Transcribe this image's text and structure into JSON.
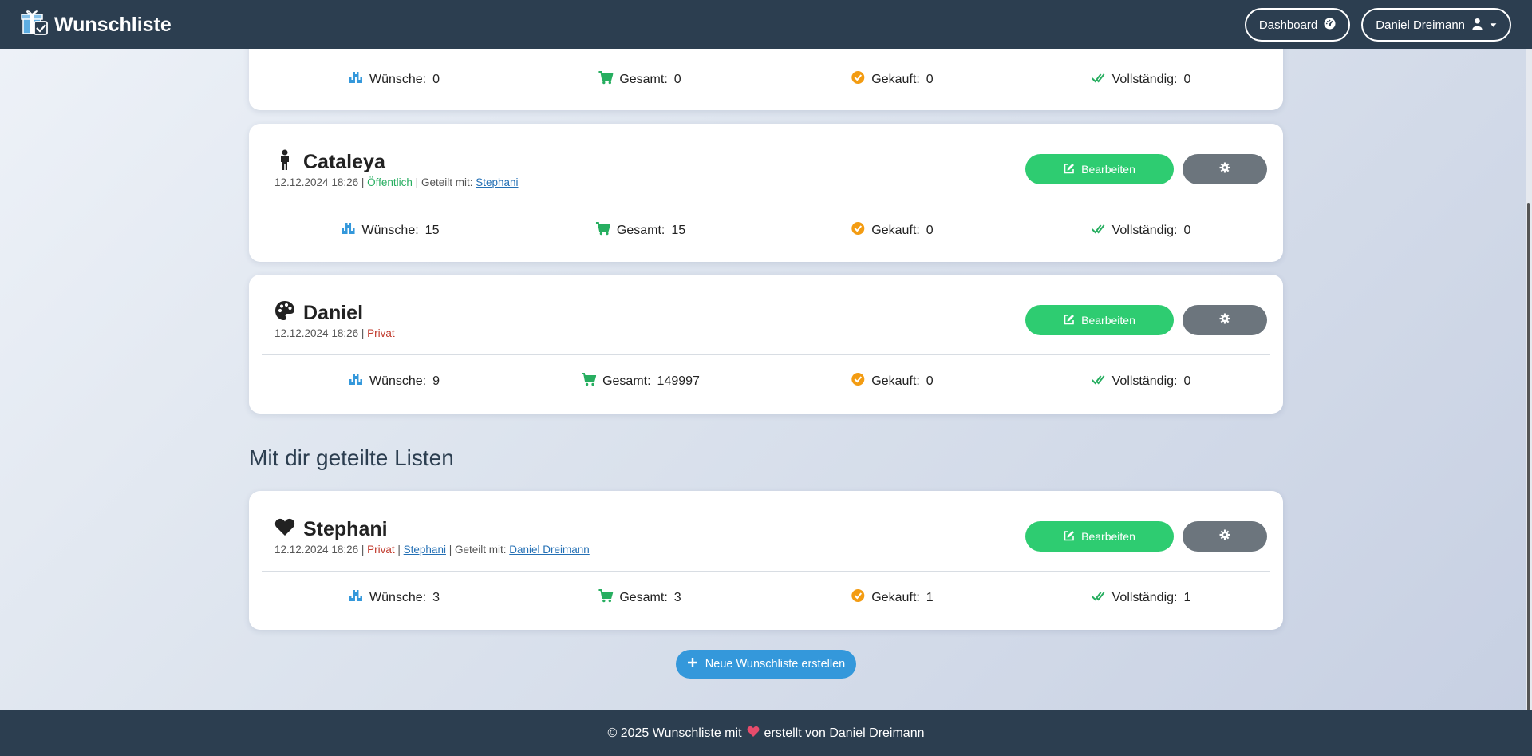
{
  "navbar": {
    "brand": "Wunschliste",
    "dashboard_label": "Dashboard",
    "user_label": "Daniel Dreimann"
  },
  "labels": {
    "edit": "Bearbeiten",
    "wishes": "Wünsche:",
    "total": "Gesamt:",
    "bought": "Gekauft:",
    "complete": "Vollständig:",
    "shared_with": "Geteilt mit:",
    "public": "Öffentlich",
    "private": "Privat"
  },
  "top_card": {
    "wishes": "0",
    "total": "0",
    "bought": "0",
    "complete": "0"
  },
  "cards": [
    {
      "title": "Cataleya",
      "icon": "child-icon",
      "date": "12.12.2024 18:26",
      "visibility": "Öffentlich",
      "shared_with": "Stephani",
      "wishes": "15",
      "total": "15",
      "bought": "0",
      "complete": "0"
    },
    {
      "title": "Daniel",
      "icon": "palette-icon",
      "date": "12.12.2024 18:26",
      "visibility": "Privat",
      "wishes": "9",
      "total": "149997",
      "bought": "0",
      "complete": "0"
    }
  ],
  "shared_section": {
    "title": "Mit dir geteilte Listen",
    "card": {
      "title": "Stephani",
      "icon": "heart-icon",
      "date": "12.12.2024 18:26",
      "visibility": "Privat",
      "owner": "Stephani",
      "shared_with": "Daniel Dreimann",
      "wishes": "3",
      "total": "3",
      "bought": "1",
      "complete": "1"
    }
  },
  "new_list_button": "Neue Wunschliste erstellen",
  "footer": {
    "prefix": "© 2025 Wunschliste mit",
    "suffix": "erstellt von Daniel Dreimann"
  },
  "colors": {
    "navbar": "#2c3e50",
    "edit_button": "#2ecc71",
    "settings_button": "#6c757d",
    "new_button": "#3498db",
    "public": "#27ae60",
    "private": "#c0392b",
    "bought_icon": "#f39c12",
    "wishes_icon": "#3498db"
  }
}
